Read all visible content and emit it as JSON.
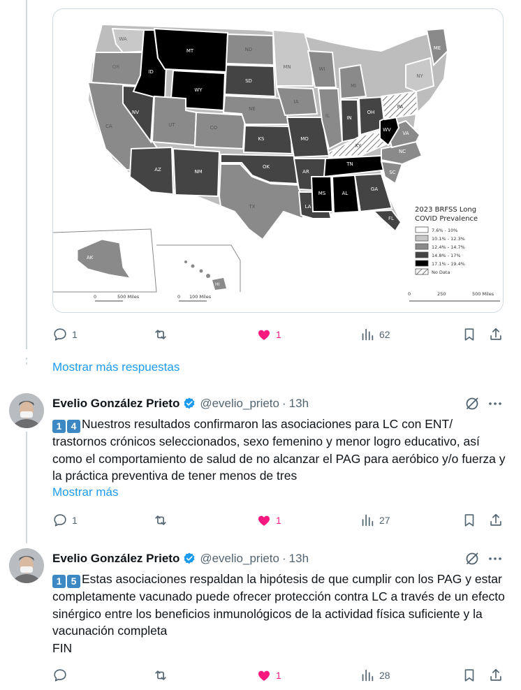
{
  "map_card": {
    "legend": {
      "title_line1": "2023 BRFSS Long",
      "title_line2": "COVID Prevalence",
      "items": [
        {
          "label": "7.6% - 10%",
          "color": "#ffffff"
        },
        {
          "label": "10.1% - 12.3%",
          "color": "#c8c8c8"
        },
        {
          "label": "12.4% - 14.7%",
          "color": "#8a8a8a"
        },
        {
          "label": "14.8% - 17%",
          "color": "#444444"
        },
        {
          "label": "17.1% - 19.4%",
          "color": "#000000"
        },
        {
          "label": "No Data",
          "color": "hatched"
        }
      ]
    },
    "scales": {
      "main": [
        "0",
        "250",
        "500 Miles"
      ],
      "alaska": [
        "0",
        "500 Miles"
      ],
      "hawaii": [
        "0",
        "100 Miles"
      ]
    },
    "state_labels": [
      "WA",
      "MT",
      "ID",
      "WY",
      "OR",
      "CA",
      "NV",
      "UT",
      "CO",
      "AZ",
      "NM",
      "ND",
      "SD",
      "NE",
      "KS",
      "OK",
      "TX",
      "MN",
      "IA",
      "MO",
      "AR",
      "LA",
      "WI",
      "IL",
      "MI",
      "IN",
      "OH",
      "KY",
      "TN",
      "MS",
      "AL",
      "GA",
      "FL",
      "SC",
      "NC",
      "VA",
      "WV",
      "PA",
      "NY",
      "ME",
      "AK",
      "HI"
    ]
  },
  "first_post_actions": {
    "replies": "1",
    "reposts": "",
    "likes": "1",
    "views": "62"
  },
  "more_replies_label": "Mostrar más respuestas",
  "posts": [
    {
      "author": "Evelio González Prieto",
      "handle": "@evelio_prieto",
      "separator": "·",
      "time": "13h",
      "keycaps": [
        "1",
        "4"
      ],
      "text": "Nuestros resultados confirmaron las asociaciones para LC con ENT/ trastornos crónicos seleccionados, sexo femenino y menor logro educativo, así como el comportamiento de salud de no alcanzar el PAG para aeróbico y/o fuerza y la práctica preventiva de tener menos de tres",
      "show_more": "Mostrar más",
      "actions": {
        "replies": "1",
        "reposts": "",
        "likes": "1",
        "views": "27"
      }
    },
    {
      "author": "Evelio González Prieto",
      "handle": "@evelio_prieto",
      "separator": "·",
      "time": "13h",
      "keycaps": [
        "1",
        "5"
      ],
      "text": "Estas asociaciones respaldan la hipótesis de que cumplir con los PAG y estar completamente vacunado puede ofrecer protección contra LC a través de un efecto sinérgico entre los beneficios inmunológicos de la actividad física suficiente y la vacunación completa",
      "text_end": "FIN",
      "actions": {
        "replies": "",
        "reposts": "",
        "likes": "1",
        "views": "28"
      }
    }
  ],
  "colors": {
    "accent": "#1d9bf0",
    "like": "#f91880",
    "muted": "#536471",
    "text": "#0f1419",
    "verified": "#1d9bf0",
    "keycap": "#3b88c3"
  },
  "icons": [
    "reply-icon",
    "repost-icon",
    "heart-icon",
    "views-icon",
    "bookmark-icon",
    "share-icon",
    "verified-icon",
    "grok-icon",
    "more-icon"
  ]
}
